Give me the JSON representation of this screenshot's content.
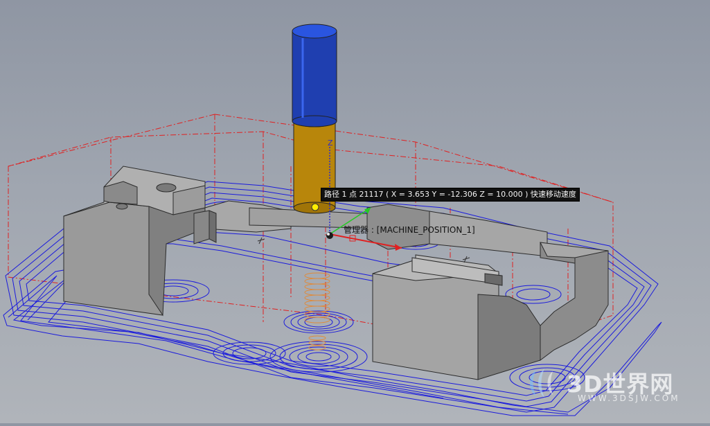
{
  "tooltip": {
    "text": "路径 1 点 21117 ( X = 3.653  Y = -12.306  Z = 10.000 ) 快速移动速度"
  },
  "machine_label": {
    "text": "管理器 : [MACHINE_POSITION_1]"
  },
  "axis_labels": {
    "z": "Z"
  },
  "watermark": {
    "main": "3D世界网",
    "sub": "WWW.3DSJW.COM"
  },
  "colors": {
    "toolpath": "#1a1adc",
    "stock_outline": "#e02020",
    "part_gray": "#8c8c8c",
    "tool_shank": "#1f3fb0",
    "tool_flute": "#b8860b",
    "tooltip_bg": "#111111",
    "axis_x": "#e02020",
    "axis_y": "#22cc22",
    "axis_z": "#2a2ad0"
  }
}
